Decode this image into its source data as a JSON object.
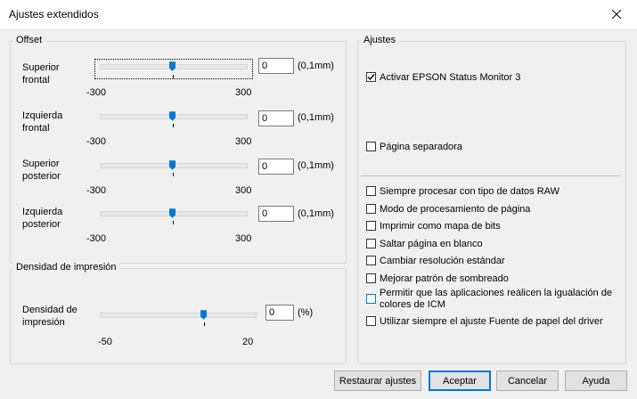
{
  "window": {
    "title": "Ajustes extendidos"
  },
  "offset": {
    "group_label": "Offset",
    "rows": [
      {
        "label_line1": "Superior",
        "label_line2": "frontal",
        "value": "0",
        "unit": "(0,1mm)",
        "min": "-300",
        "max": "300",
        "slider_value": 0
      },
      {
        "label_line1": "Izquierda",
        "label_line2": "frontal",
        "value": "0",
        "unit": "(0,1mm)",
        "min": "-300",
        "max": "300",
        "slider_value": 0
      },
      {
        "label_line1": "Superior",
        "label_line2": "posterior",
        "value": "0",
        "unit": "(0,1mm)",
        "min": "-300",
        "max": "300",
        "slider_value": 0
      },
      {
        "label_line1": "Izquierda",
        "label_line2": "posterior",
        "value": "0",
        "unit": "(0,1mm)",
        "min": "-300",
        "max": "300",
        "slider_value": 0
      }
    ]
  },
  "density": {
    "group_label": "Densidad de impresión",
    "label_line1": "Densidad de",
    "label_line2": "impresión",
    "value": "0",
    "unit": "(%)",
    "min": "-50",
    "max": "20",
    "slider_value": 0
  },
  "settings": {
    "group_label": "Ajustes",
    "checkboxes": [
      {
        "label": "Activar EPSON Status Monitor 3",
        "checked": true
      },
      {
        "label": "Página separadora",
        "checked": false
      },
      {
        "label": "Siempre procesar con tipo de datos RAW",
        "checked": false
      },
      {
        "label": "Modo de procesamiento de página",
        "checked": false
      },
      {
        "label": "Imprimir como mapa de bits",
        "checked": false
      },
      {
        "label": "Saltar página en blanco",
        "checked": false
      },
      {
        "label": "Cambiar resolución estándar",
        "checked": false
      },
      {
        "label": "Mejorar patrón de sombreado",
        "checked": false
      },
      {
        "label_line1": "Permitir que las aplicaciones realicen la igualación de",
        "label_line2": "colores de ICM",
        "checked": false
      },
      {
        "label": "Utilizar siempre el ajuste Fuente de papel del driver",
        "checked": false
      }
    ]
  },
  "buttons": {
    "restore": "Restaurar ajustes",
    "ok": "Aceptar",
    "cancel": "Cancelar",
    "help": "Ayuda"
  },
  "colors": {
    "slider_thumb": "#0078d7",
    "focus_border": "#0078d7"
  }
}
